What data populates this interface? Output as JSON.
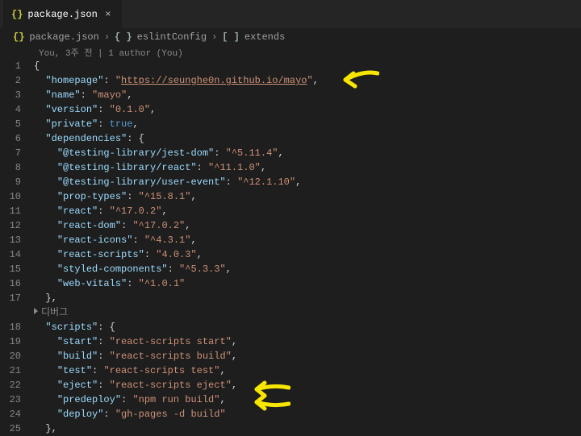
{
  "tab": {
    "title": "package.json",
    "close": "×",
    "icon": "{}"
  },
  "breadcrumbs": {
    "icon1": "{}",
    "file": "package.json",
    "icon2": "{ }",
    "section": "eslintConfig",
    "icon3": "[  ]",
    "sub": "extends",
    "sep": "›"
  },
  "codelens": "You, 3주 전 | 1 author (You)",
  "lines": [
    {
      "n": "1",
      "i": 0,
      "tokens": [
        {
          "c": "punct",
          "t": "{"
        }
      ]
    },
    {
      "n": "2",
      "i": 1,
      "tokens": [
        {
          "c": "key",
          "t": "\"homepage\""
        },
        {
          "c": "punct",
          "t": ": "
        },
        {
          "c": "str",
          "t": "\""
        },
        {
          "c": "url",
          "t": "https://seunghe0n.github.io/mayo"
        },
        {
          "c": "str",
          "t": "\""
        },
        {
          "c": "punct",
          "t": ","
        }
      ]
    },
    {
      "n": "3",
      "i": 1,
      "tokens": [
        {
          "c": "key",
          "t": "\"name\""
        },
        {
          "c": "punct",
          "t": ": "
        },
        {
          "c": "str",
          "t": "\"mayo\""
        },
        {
          "c": "punct",
          "t": ","
        }
      ]
    },
    {
      "n": "4",
      "i": 1,
      "tokens": [
        {
          "c": "key",
          "t": "\"version\""
        },
        {
          "c": "punct",
          "t": ": "
        },
        {
          "c": "str",
          "t": "\"0.1.0\""
        },
        {
          "c": "punct",
          "t": ","
        }
      ]
    },
    {
      "n": "5",
      "i": 1,
      "tokens": [
        {
          "c": "key",
          "t": "\"private\""
        },
        {
          "c": "punct",
          "t": ": "
        },
        {
          "c": "kw",
          "t": "true"
        },
        {
          "c": "punct",
          "t": ","
        }
      ]
    },
    {
      "n": "6",
      "i": 1,
      "tokens": [
        {
          "c": "key",
          "t": "\"dependencies\""
        },
        {
          "c": "punct",
          "t": ": {"
        }
      ]
    },
    {
      "n": "7",
      "i": 2,
      "tokens": [
        {
          "c": "key",
          "t": "\"@testing-library/jest-dom\""
        },
        {
          "c": "punct",
          "t": ": "
        },
        {
          "c": "str",
          "t": "\"^5.11.4\""
        },
        {
          "c": "punct",
          "t": ","
        }
      ]
    },
    {
      "n": "8",
      "i": 2,
      "tokens": [
        {
          "c": "key",
          "t": "\"@testing-library/react\""
        },
        {
          "c": "punct",
          "t": ": "
        },
        {
          "c": "str",
          "t": "\"^11.1.0\""
        },
        {
          "c": "punct",
          "t": ","
        }
      ]
    },
    {
      "n": "9",
      "i": 2,
      "tokens": [
        {
          "c": "key",
          "t": "\"@testing-library/user-event\""
        },
        {
          "c": "punct",
          "t": ": "
        },
        {
          "c": "str",
          "t": "\"^12.1.10\""
        },
        {
          "c": "punct",
          "t": ","
        }
      ]
    },
    {
      "n": "10",
      "i": 2,
      "tokens": [
        {
          "c": "key",
          "t": "\"prop-types\""
        },
        {
          "c": "punct",
          "t": ": "
        },
        {
          "c": "str",
          "t": "\"^15.8.1\""
        },
        {
          "c": "punct",
          "t": ","
        }
      ]
    },
    {
      "n": "11",
      "i": 2,
      "tokens": [
        {
          "c": "key",
          "t": "\"react\""
        },
        {
          "c": "punct",
          "t": ": "
        },
        {
          "c": "str",
          "t": "\"^17.0.2\""
        },
        {
          "c": "punct",
          "t": ","
        }
      ]
    },
    {
      "n": "12",
      "i": 2,
      "tokens": [
        {
          "c": "key",
          "t": "\"react-dom\""
        },
        {
          "c": "punct",
          "t": ": "
        },
        {
          "c": "str",
          "t": "\"^17.0.2\""
        },
        {
          "c": "punct",
          "t": ","
        }
      ]
    },
    {
      "n": "13",
      "i": 2,
      "tokens": [
        {
          "c": "key",
          "t": "\"react-icons\""
        },
        {
          "c": "punct",
          "t": ": "
        },
        {
          "c": "str",
          "t": "\"^4.3.1\""
        },
        {
          "c": "punct",
          "t": ","
        }
      ]
    },
    {
      "n": "14",
      "i": 2,
      "tokens": [
        {
          "c": "key",
          "t": "\"react-scripts\""
        },
        {
          "c": "punct",
          "t": ": "
        },
        {
          "c": "str",
          "t": "\"4.0.3\""
        },
        {
          "c": "punct",
          "t": ","
        }
      ]
    },
    {
      "n": "15",
      "i": 2,
      "tokens": [
        {
          "c": "key",
          "t": "\"styled-components\""
        },
        {
          "c": "punct",
          "t": ": "
        },
        {
          "c": "str",
          "t": "\"^5.3.3\""
        },
        {
          "c": "punct",
          "t": ","
        }
      ]
    },
    {
      "n": "16",
      "i": 2,
      "tokens": [
        {
          "c": "key",
          "t": "\"web-vitals\""
        },
        {
          "c": "punct",
          "t": ": "
        },
        {
          "c": "str",
          "t": "\"^1.0.1\""
        }
      ]
    },
    {
      "n": "17",
      "i": 1,
      "tokens": [
        {
          "c": "punct",
          "t": "},"
        }
      ]
    }
  ],
  "debug_hint": "디버그",
  "lines2": [
    {
      "n": "18",
      "i": 1,
      "tokens": [
        {
          "c": "key",
          "t": "\"scripts\""
        },
        {
          "c": "punct",
          "t": ": {"
        }
      ]
    },
    {
      "n": "19",
      "i": 2,
      "tokens": [
        {
          "c": "key",
          "t": "\"start\""
        },
        {
          "c": "punct",
          "t": ": "
        },
        {
          "c": "str",
          "t": "\"react-scripts start\""
        },
        {
          "c": "punct",
          "t": ","
        }
      ]
    },
    {
      "n": "20",
      "i": 2,
      "tokens": [
        {
          "c": "key",
          "t": "\"build\""
        },
        {
          "c": "punct",
          "t": ": "
        },
        {
          "c": "str",
          "t": "\"react-scripts build\""
        },
        {
          "c": "punct",
          "t": ","
        }
      ]
    },
    {
      "n": "21",
      "i": 2,
      "tokens": [
        {
          "c": "key",
          "t": "\"test\""
        },
        {
          "c": "punct",
          "t": ": "
        },
        {
          "c": "str",
          "t": "\"react-scripts test\""
        },
        {
          "c": "punct",
          "t": ","
        }
      ]
    },
    {
      "n": "22",
      "i": 2,
      "tokens": [
        {
          "c": "key",
          "t": "\"eject\""
        },
        {
          "c": "punct",
          "t": ": "
        },
        {
          "c": "str",
          "t": "\"react-scripts eject\""
        },
        {
          "c": "punct",
          "t": ","
        }
      ]
    },
    {
      "n": "23",
      "i": 2,
      "tokens": [
        {
          "c": "key",
          "t": "\"predeploy\""
        },
        {
          "c": "punct",
          "t": ": "
        },
        {
          "c": "str",
          "t": "\"npm run build\""
        },
        {
          "c": "punct",
          "t": ","
        }
      ]
    },
    {
      "n": "24",
      "i": 2,
      "tokens": [
        {
          "c": "key",
          "t": "\"deploy\""
        },
        {
          "c": "punct",
          "t": ": "
        },
        {
          "c": "str",
          "t": "\"gh-pages -d build\""
        }
      ]
    },
    {
      "n": "25",
      "i": 1,
      "tokens": [
        {
          "c": "punct",
          "t": "},"
        }
      ]
    }
  ],
  "annotations": {
    "arrows": [
      {
        "target_line": 2,
        "desc": "homepage-arrow"
      },
      {
        "target_line": 23,
        "desc": "predeploy-arrow"
      },
      {
        "target_line": 24,
        "desc": "deploy-arrow"
      }
    ],
    "color": "#f7e600"
  }
}
